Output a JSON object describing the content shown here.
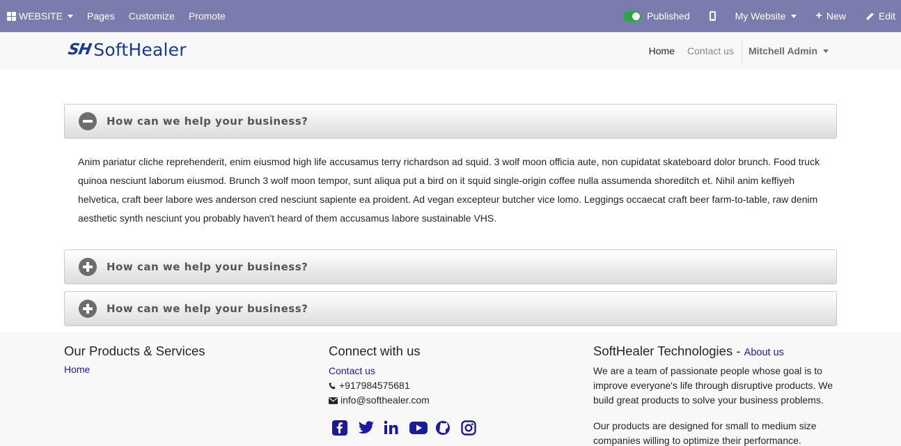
{
  "admin_bar": {
    "website_label": "WEBSITE",
    "pages_label": "Pages",
    "customize_label": "Customize",
    "promote_label": "Promote",
    "published_label": "Published",
    "my_website_label": "My Website",
    "new_label": "New",
    "edit_label": "Edit"
  },
  "header": {
    "logo_mark": "SH",
    "logo_text": "SoftHealer",
    "nav": {
      "home": "Home",
      "contact": "Contact us",
      "user": "Mitchell Admin"
    }
  },
  "accordion": [
    {
      "title": "How can we help your business?",
      "expanded": true,
      "body": "Anim pariatur cliche reprehenderit, enim eiusmod high life accusamus terry richardson ad squid. 3 wolf moon officia aute, non cupidatat skateboard dolor brunch. Food truck quinoa nesciunt laborum eiusmod. Brunch 3 wolf moon tempor, sunt aliqua put a bird on it squid single-origin coffee nulla assumenda shoreditch et. Nihil anim keffiyeh helvetica, craft beer labore wes anderson cred nesciunt sapiente ea proident. Ad vegan excepteur butcher vice lomo. Leggings occaecat craft beer farm-to-table, raw denim aesthetic synth nesciunt you probably haven't heard of them accusamus labore sustainable VHS."
    },
    {
      "title": "How can we help your business?",
      "expanded": false
    },
    {
      "title": "How can we help your business?",
      "expanded": false
    }
  ],
  "footer": {
    "products": {
      "heading": "Our Products & Services",
      "home_link": "Home"
    },
    "connect": {
      "heading": "Connect with us",
      "contact_link": "Contact us",
      "phone": "+917984575681",
      "email": "info@softhealer.com",
      "social": [
        "facebook-icon",
        "twitter-icon",
        "linkedin-icon",
        "youtube-icon",
        "github-icon",
        "instagram-icon"
      ]
    },
    "company": {
      "heading": "SoftHealer Technologies",
      "separator": " - ",
      "about_link": "About us",
      "para1": "We are a team of passionate people whose goal is to improve everyone's life through disruptive products. We build great products to solve your business problems.",
      "para2": "Our products are designed for small to medium size companies willing to optimize their performance."
    }
  },
  "colors": {
    "admin_bar": "#7c7bad",
    "link": "#1a1a9e",
    "logo": "#1a3a8f",
    "toggle_on": "#28a745"
  }
}
